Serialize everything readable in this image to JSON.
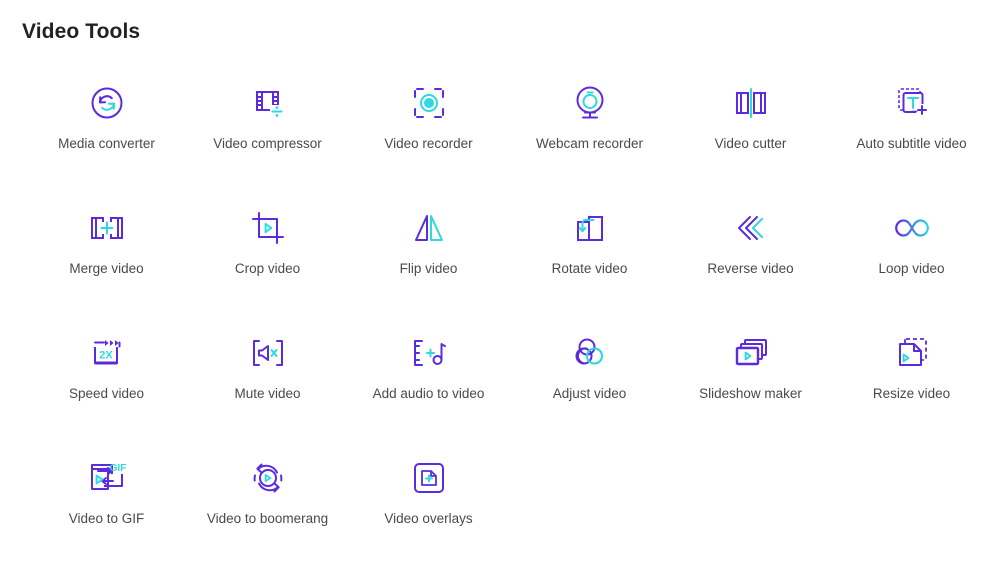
{
  "page": {
    "title": "Video Tools",
    "background": "#ffffff",
    "accent_purple": "#5b2be0",
    "accent_cyan": "#2ed9e0",
    "label_color": "#4a4a4a"
  },
  "tools": [
    {
      "label": "Media converter",
      "icon": "media-converter-icon"
    },
    {
      "label": "Video compressor",
      "icon": "video-compressor-icon"
    },
    {
      "label": "Video recorder",
      "icon": "video-recorder-icon"
    },
    {
      "label": "Webcam recorder",
      "icon": "webcam-recorder-icon"
    },
    {
      "label": "Video cutter",
      "icon": "video-cutter-icon"
    },
    {
      "label": "Auto subtitle video",
      "icon": "auto-subtitle-video-icon"
    },
    {
      "label": "Merge video",
      "icon": "merge-video-icon"
    },
    {
      "label": "Crop video",
      "icon": "crop-video-icon"
    },
    {
      "label": "Flip video",
      "icon": "flip-video-icon"
    },
    {
      "label": "Rotate video",
      "icon": "rotate-video-icon"
    },
    {
      "label": "Reverse video",
      "icon": "reverse-video-icon"
    },
    {
      "label": "Loop video",
      "icon": "loop-video-icon"
    },
    {
      "label": "Speed video",
      "icon": "speed-video-icon"
    },
    {
      "label": "Mute video",
      "icon": "mute-video-icon"
    },
    {
      "label": "Add audio to video",
      "icon": "add-audio-to-video-icon"
    },
    {
      "label": "Adjust video",
      "icon": "adjust-video-icon"
    },
    {
      "label": "Slideshow maker",
      "icon": "slideshow-maker-icon"
    },
    {
      "label": "Resize video",
      "icon": "resize-video-icon"
    },
    {
      "label": "Video to GIF",
      "icon": "video-to-gif-icon"
    },
    {
      "label": "Video to boomerang",
      "icon": "video-to-boomerang-icon"
    },
    {
      "label": "Video overlays",
      "icon": "video-overlays-icon"
    }
  ],
  "icon_text": {
    "speed_label": "2X",
    "subtitle_letter": "T",
    "gif_label": "GIF"
  }
}
